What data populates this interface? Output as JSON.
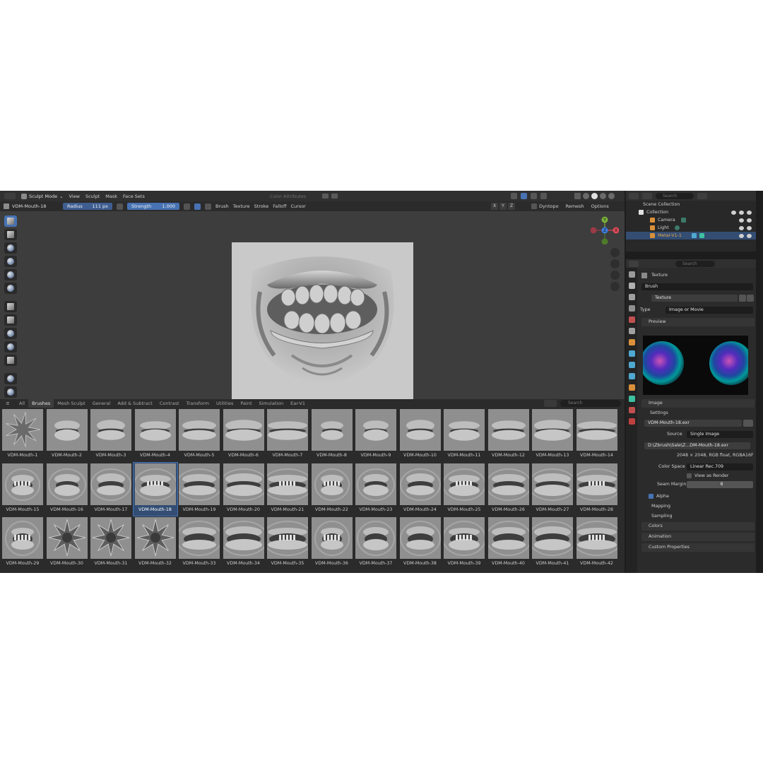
{
  "header": {
    "mode": "Sculpt Mode",
    "menus": [
      "View",
      "Sculpt",
      "Mask",
      "Face Sets"
    ],
    "color_attributes": "Color Attributes"
  },
  "tool_settings": {
    "brush_name": "VDM-Mouth-18",
    "radius_label": "Radius",
    "radius_value": "111 px",
    "strength_label": "Strength",
    "strength_value": "1.000",
    "menus": [
      "Brush",
      "Texture",
      "Stroke",
      "Falloff",
      "Cursor"
    ],
    "axes": [
      "X",
      "Y",
      "Z"
    ],
    "dyntopo": "Dyntopo",
    "remesh": "Remesh",
    "options": "Options"
  },
  "gizmo": {
    "x": "X",
    "y": "Y",
    "z": "Z"
  },
  "shelf": {
    "tabs": [
      "All",
      "Brushes",
      "Mesh Sculpt",
      "General",
      "Add & Subtract",
      "Contrast",
      "Transform",
      "Utilities",
      "Paint",
      "Simulation",
      "Ear-V1"
    ],
    "active_tab": "Brushes",
    "search_placeholder": "Search",
    "selected": "VDM-Mouth-18",
    "brushes": [
      "VDM-Mouth-1",
      "VDM-Mouth-2",
      "VDM-Mouth-3",
      "VDM-Mouth-4",
      "VDM-Mouth-5",
      "VDM-Mouth-6",
      "VDM-Mouth-7",
      "VDM-Mouth-8",
      "VDM-Mouth-9",
      "VDM-Mouth-10",
      "VDM-Mouth-11",
      "VDM-Mouth-12",
      "VDM-Mouth-13",
      "VDM-Mouth-14",
      "VDM-Mouth-15",
      "VDM-Mouth-16",
      "VDM-Mouth-17",
      "VDM-Mouth-18",
      "VDM-Mouth-19",
      "VDM-Mouth-20",
      "VDM-Mouth-21",
      "VDM-Mouth-22",
      "VDM-Mouth-23",
      "VDM-Mouth-24",
      "VDM-Mouth-25",
      "VDM-Mouth-26",
      "VDM-Mouth-27",
      "VDM-Mouth-28",
      "VDM-Mouth-29",
      "VDM-Mouth-30",
      "VDM-Mouth-31",
      "VDM-Mouth-32",
      "VDM-Mouth-33",
      "VDM-Mouth-34",
      "VDM-Mouth-35",
      "VDM-Mouth-36",
      "VDM-Mouth-37",
      "VDM-Mouth-38",
      "VDM-Mouth-39",
      "VDM-Mouth-40",
      "VDM-Mouth-41",
      "VDM-Mouth-42"
    ]
  },
  "outliner": {
    "search_placeholder": "Search",
    "scene_collection": "Scene Collection",
    "collection": "Collection",
    "items": [
      "Camera",
      "Light",
      "Metal-V1-1"
    ]
  },
  "properties": {
    "search_placeholder": "Search",
    "context_title": "Texture",
    "brush_label": "Brush",
    "texture_name": "Texture",
    "type_label": "Type",
    "type_value": "Image or Movie",
    "preview_panel": "Preview",
    "image_panel": "Image",
    "settings_sub": "Settings",
    "image_file": "VDM-Mouth-18.exr",
    "source_label": "Source",
    "source_value": "Single Image",
    "path": "D:\\Zbrush\\Sale\\Z...DM-Mouth-18.exr",
    "image_info": "2048 × 2048, RGB float, RGBA16F",
    "color_space_label": "Color Space",
    "color_space_value": "Linear Rec.709",
    "view_as_render": "View as Render",
    "seam_margin_label": "Seam Margin",
    "seam_margin_value": "8",
    "alpha": "Alpha",
    "mapping": "Mapping",
    "sampling": "Sampling",
    "colors": "Colors",
    "animation": "Animation",
    "custom_properties": "Custom Properties"
  },
  "colors": {
    "accent": "#4772b3",
    "selected_object": "#e8a64d",
    "axis_x": "#e04a5a",
    "axis_y": "#7ab13a",
    "axis_z": "#3c7ee0"
  }
}
